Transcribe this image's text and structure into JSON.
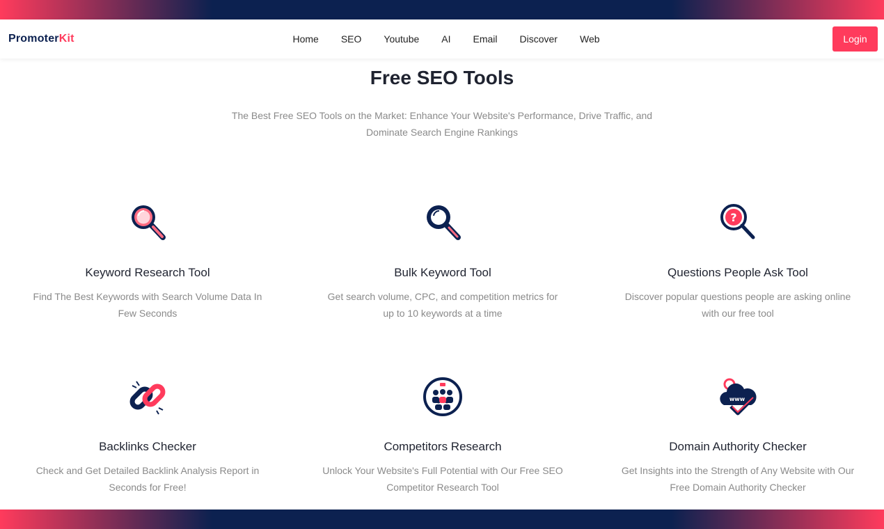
{
  "brand": {
    "part1": "Promoter",
    "part2": "Kit"
  },
  "nav": {
    "items": [
      {
        "label": "Home"
      },
      {
        "label": "SEO"
      },
      {
        "label": "Youtube"
      },
      {
        "label": "AI"
      },
      {
        "label": "Email"
      },
      {
        "label": "Discover"
      },
      {
        "label": "Web"
      }
    ],
    "login_label": "Login"
  },
  "hero": {
    "title": "Free SEO Tools",
    "subtitle": "The Best Free SEO Tools on the Market: Enhance Your Website's Performance, Drive Traffic, and Dominate Search Engine Rankings"
  },
  "tools": [
    {
      "title": "Keyword Research Tool",
      "desc": "Find The Best Keywords with Search Volume Data In Few Seconds",
      "icon": "magnifier-icon"
    },
    {
      "title": "Bulk Keyword Tool",
      "desc": "Get search volume, CPC, and competition metrics for up to 10 keywords at a time",
      "icon": "magnifier-dark-icon"
    },
    {
      "title": "Questions People Ask Tool",
      "desc": "Discover popular questions people are asking online with our free tool",
      "icon": "question-magnifier-icon"
    },
    {
      "title": "Backlinks Checker",
      "desc": "Check and Get Detailed Backlink Analysis Report in Seconds for Free!",
      "icon": "chain-link-icon"
    },
    {
      "title": "Competitors Research",
      "desc": "Unlock Your Website's Full Potential with Our Free SEO Competitor Research Tool",
      "icon": "group-people-icon"
    },
    {
      "title": "Domain Authority Checker",
      "desc": "Get Insights into the Strength of Any Website with Our Free Domain Authority Checker",
      "icon": "www-check-icon",
      "icon_text": "www"
    }
  ],
  "colors": {
    "accent": "#ff3b5c",
    "navy": "#0c2150",
    "muted": "#8a8a8a"
  }
}
